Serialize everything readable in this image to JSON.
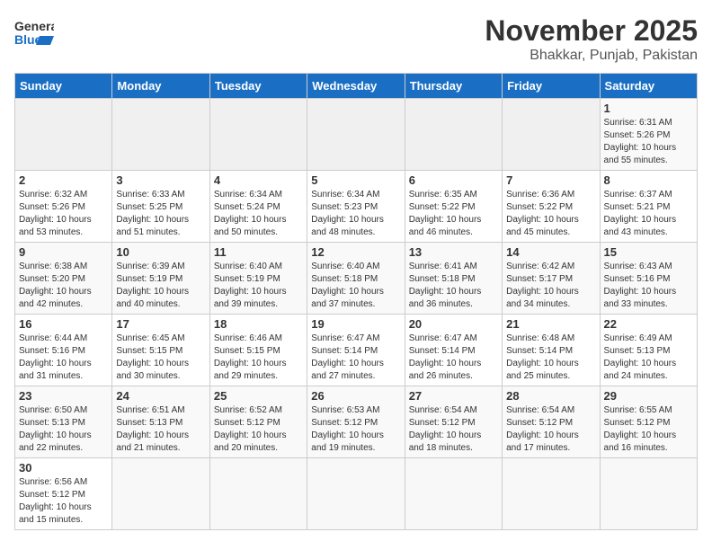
{
  "header": {
    "logo_general": "General",
    "logo_blue": "Blue",
    "title": "November 2025",
    "subtitle": "Bhakkar, Punjab, Pakistan"
  },
  "calendar": {
    "weekdays": [
      "Sunday",
      "Monday",
      "Tuesday",
      "Wednesday",
      "Thursday",
      "Friday",
      "Saturday"
    ],
    "weeks": [
      [
        {
          "day": "",
          "info": ""
        },
        {
          "day": "",
          "info": ""
        },
        {
          "day": "",
          "info": ""
        },
        {
          "day": "",
          "info": ""
        },
        {
          "day": "",
          "info": ""
        },
        {
          "day": "",
          "info": ""
        },
        {
          "day": "1",
          "info": "Sunrise: 6:31 AM\nSunset: 5:26 PM\nDaylight: 10 hours\nand 55 minutes."
        }
      ],
      [
        {
          "day": "2",
          "info": "Sunrise: 6:32 AM\nSunset: 5:26 PM\nDaylight: 10 hours\nand 53 minutes."
        },
        {
          "day": "3",
          "info": "Sunrise: 6:33 AM\nSunset: 5:25 PM\nDaylight: 10 hours\nand 51 minutes."
        },
        {
          "day": "4",
          "info": "Sunrise: 6:34 AM\nSunset: 5:24 PM\nDaylight: 10 hours\nand 50 minutes."
        },
        {
          "day": "5",
          "info": "Sunrise: 6:34 AM\nSunset: 5:23 PM\nDaylight: 10 hours\nand 48 minutes."
        },
        {
          "day": "6",
          "info": "Sunrise: 6:35 AM\nSunset: 5:22 PM\nDaylight: 10 hours\nand 46 minutes."
        },
        {
          "day": "7",
          "info": "Sunrise: 6:36 AM\nSunset: 5:22 PM\nDaylight: 10 hours\nand 45 minutes."
        },
        {
          "day": "8",
          "info": "Sunrise: 6:37 AM\nSunset: 5:21 PM\nDaylight: 10 hours\nand 43 minutes."
        }
      ],
      [
        {
          "day": "9",
          "info": "Sunrise: 6:38 AM\nSunset: 5:20 PM\nDaylight: 10 hours\nand 42 minutes."
        },
        {
          "day": "10",
          "info": "Sunrise: 6:39 AM\nSunset: 5:19 PM\nDaylight: 10 hours\nand 40 minutes."
        },
        {
          "day": "11",
          "info": "Sunrise: 6:40 AM\nSunset: 5:19 PM\nDaylight: 10 hours\nand 39 minutes."
        },
        {
          "day": "12",
          "info": "Sunrise: 6:40 AM\nSunset: 5:18 PM\nDaylight: 10 hours\nand 37 minutes."
        },
        {
          "day": "13",
          "info": "Sunrise: 6:41 AM\nSunset: 5:18 PM\nDaylight: 10 hours\nand 36 minutes."
        },
        {
          "day": "14",
          "info": "Sunrise: 6:42 AM\nSunset: 5:17 PM\nDaylight: 10 hours\nand 34 minutes."
        },
        {
          "day": "15",
          "info": "Sunrise: 6:43 AM\nSunset: 5:16 PM\nDaylight: 10 hours\nand 33 minutes."
        }
      ],
      [
        {
          "day": "16",
          "info": "Sunrise: 6:44 AM\nSunset: 5:16 PM\nDaylight: 10 hours\nand 31 minutes."
        },
        {
          "day": "17",
          "info": "Sunrise: 6:45 AM\nSunset: 5:15 PM\nDaylight: 10 hours\nand 30 minutes."
        },
        {
          "day": "18",
          "info": "Sunrise: 6:46 AM\nSunset: 5:15 PM\nDaylight: 10 hours\nand 29 minutes."
        },
        {
          "day": "19",
          "info": "Sunrise: 6:47 AM\nSunset: 5:14 PM\nDaylight: 10 hours\nand 27 minutes."
        },
        {
          "day": "20",
          "info": "Sunrise: 6:47 AM\nSunset: 5:14 PM\nDaylight: 10 hours\nand 26 minutes."
        },
        {
          "day": "21",
          "info": "Sunrise: 6:48 AM\nSunset: 5:14 PM\nDaylight: 10 hours\nand 25 minutes."
        },
        {
          "day": "22",
          "info": "Sunrise: 6:49 AM\nSunset: 5:13 PM\nDaylight: 10 hours\nand 24 minutes."
        }
      ],
      [
        {
          "day": "23",
          "info": "Sunrise: 6:50 AM\nSunset: 5:13 PM\nDaylight: 10 hours\nand 22 minutes."
        },
        {
          "day": "24",
          "info": "Sunrise: 6:51 AM\nSunset: 5:13 PM\nDaylight: 10 hours\nand 21 minutes."
        },
        {
          "day": "25",
          "info": "Sunrise: 6:52 AM\nSunset: 5:12 PM\nDaylight: 10 hours\nand 20 minutes."
        },
        {
          "day": "26",
          "info": "Sunrise: 6:53 AM\nSunset: 5:12 PM\nDaylight: 10 hours\nand 19 minutes."
        },
        {
          "day": "27",
          "info": "Sunrise: 6:54 AM\nSunset: 5:12 PM\nDaylight: 10 hours\nand 18 minutes."
        },
        {
          "day": "28",
          "info": "Sunrise: 6:54 AM\nSunset: 5:12 PM\nDaylight: 10 hours\nand 17 minutes."
        },
        {
          "day": "29",
          "info": "Sunrise: 6:55 AM\nSunset: 5:12 PM\nDaylight: 10 hours\nand 16 minutes."
        }
      ],
      [
        {
          "day": "30",
          "info": "Sunrise: 6:56 AM\nSunset: 5:12 PM\nDaylight: 10 hours\nand 15 minutes."
        },
        {
          "day": "",
          "info": ""
        },
        {
          "day": "",
          "info": ""
        },
        {
          "day": "",
          "info": ""
        },
        {
          "day": "",
          "info": ""
        },
        {
          "day": "",
          "info": ""
        },
        {
          "day": "",
          "info": ""
        }
      ]
    ]
  }
}
